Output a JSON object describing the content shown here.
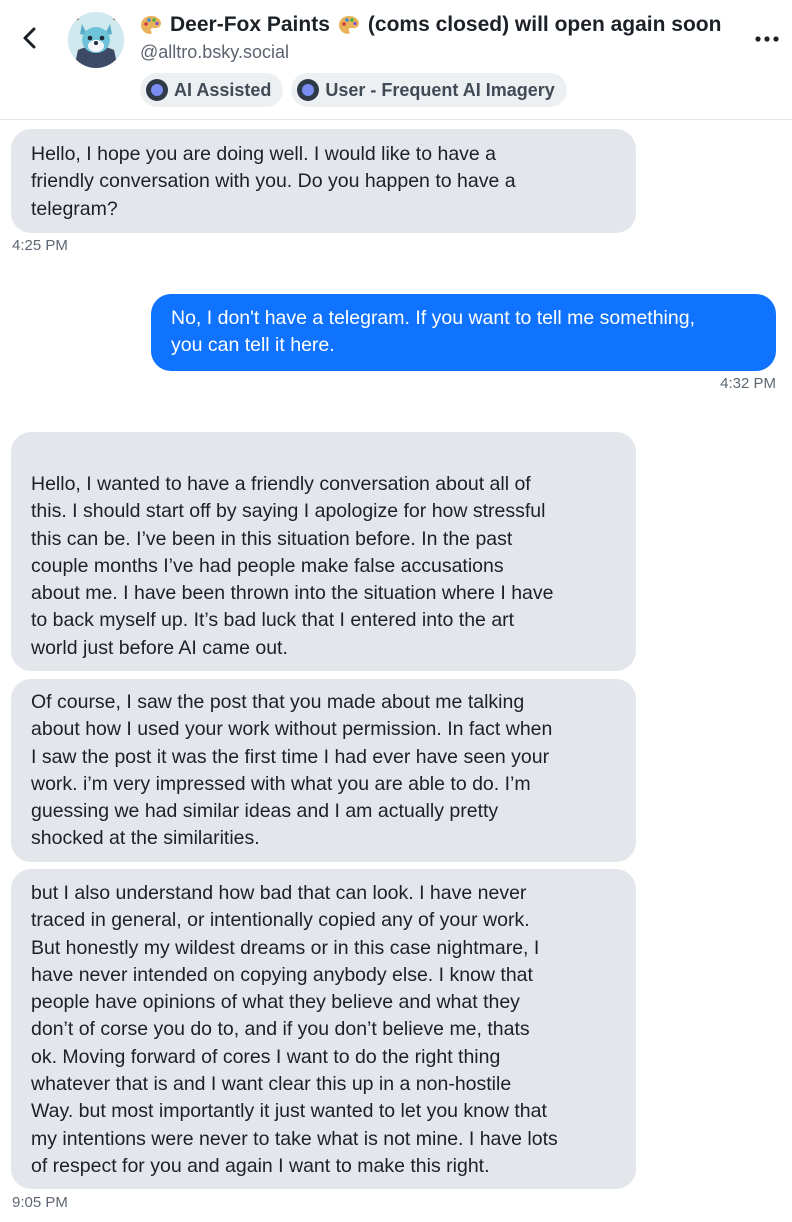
{
  "header": {
    "display_name": "Deer-Fox Paints",
    "name_suffix": "(coms closed) will open again soon",
    "handle": "@alltro.bsky.social",
    "labels": [
      {
        "text": "AI Assisted",
        "icon": "label-icon"
      },
      {
        "text": "User - Frequent AI Imagery",
        "icon": "label-icon"
      }
    ]
  },
  "messages": [
    {
      "direction": "incoming",
      "text": "Hello, I hope you are doing well. I would like to have a\nfriendly conversation with you. Do you happen to have a\ntelegram?",
      "time": "4:25 PM"
    },
    {
      "direction": "outgoing",
      "text": "No, I don't have a telegram. If you want to tell me something,\nyou can tell it here.",
      "time": "4:32 PM"
    },
    {
      "direction": "incoming",
      "text": "Hello, I wanted to have a friendly conversation about all of\nthis. I should start off by saying I apologize for how stressful\nthis can be. I’ve been in this situation before.  In the past\ncouple months I’ve had people make false accusations\nabout me. I have been thrown into the situation where I have\nto back myself up. It’s bad luck that I entered into the art\nworld just before AI came out."
    },
    {
      "direction": "incoming",
      "text": "Of course, I saw the post that you made about me talking\nabout how I used your work without permission. In fact when\nI saw the post it was the first time I had ever have seen your\nwork. i’m very impressed with what you are able to do. I’m\nguessing we had similar ideas and I am actually pretty\nshocked at the similarities."
    },
    {
      "direction": "incoming",
      "text": "but I also understand how bad that can look. I have never\ntraced in general, or intentionally copied any of your work.\nBut honestly my wildest dreams or in this case nightmare, I\nhave never intended on copying anybody else. I know that\npeople have opinions of what they believe and what they\ndon’t of corse you do to, and if you don’t believe me, thats\nok. Moving forward of cores I want to do the right thing\nwhatever that is and I want clear this up in a non-hostile\nWay.  but most importantly it just wanted to let you know that\nmy intentions were never to take what is not mine. I have lots\nof respect for you and again I want to make this right.",
      "time": "9:05 PM"
    }
  ],
  "colors": {
    "incoming_bubble": "#e3e7eb",
    "outgoing_bubble": "#0f73ff",
    "timestamp": "#5d6772"
  }
}
